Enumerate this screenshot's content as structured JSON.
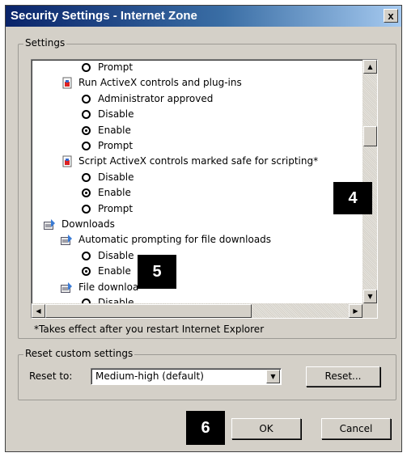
{
  "window": {
    "title": "Security Settings - Internet Zone",
    "close_label": "x"
  },
  "settings": {
    "legend": "Settings",
    "rows": [
      {
        "kind": "radio",
        "indent": 1,
        "label": "Prompt",
        "checked": false
      },
      {
        "kind": "item",
        "icon": "setting-document-icon",
        "label": "Run ActiveX controls and plug-ins"
      },
      {
        "kind": "radio",
        "indent": 1,
        "label": "Administrator approved",
        "checked": false
      },
      {
        "kind": "radio",
        "indent": 1,
        "label": "Disable",
        "checked": false
      },
      {
        "kind": "radio",
        "indent": 1,
        "label": "Enable",
        "checked": true
      },
      {
        "kind": "radio",
        "indent": 1,
        "label": "Prompt",
        "checked": false
      },
      {
        "kind": "item",
        "icon": "setting-document-icon",
        "label": "Script ActiveX controls marked safe for scripting*"
      },
      {
        "kind": "radio",
        "indent": 1,
        "label": "Disable",
        "checked": false
      },
      {
        "kind": "radio",
        "indent": 1,
        "label": "Enable",
        "checked": true
      },
      {
        "kind": "radio",
        "indent": 1,
        "label": "Prompt",
        "checked": false
      },
      {
        "kind": "category",
        "icon": "downloads-icon",
        "label": "Downloads"
      },
      {
        "kind": "subitem",
        "icon": "downloads-icon",
        "label": "Automatic prompting for file downloads"
      },
      {
        "kind": "radio",
        "indent": 1,
        "label": "Disable",
        "checked": false
      },
      {
        "kind": "radio",
        "indent": 1,
        "label": "Enable",
        "checked": true
      },
      {
        "kind": "subitem",
        "icon": "downloads-icon",
        "label": "File downloa"
      },
      {
        "kind": "radio",
        "indent": 1,
        "label": "Disable",
        "checked": false
      }
    ]
  },
  "note": "*Takes effect after you restart Internet Explorer",
  "reset_group": {
    "legend": "Reset custom settings",
    "reset_to_label": "Reset to:",
    "selected": "Medium-high (default)",
    "reset_button": "Reset..."
  },
  "buttons": {
    "ok": "OK",
    "cancel": "Cancel"
  },
  "badges": {
    "b4": "4",
    "b5": "5",
    "b6": "6"
  }
}
